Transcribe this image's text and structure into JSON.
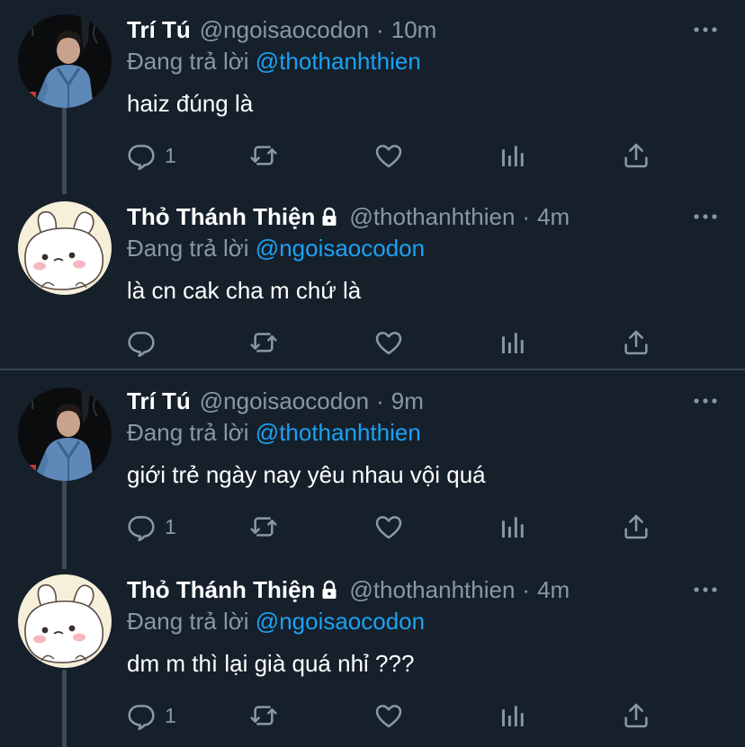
{
  "colors": {
    "background": "#15202b",
    "text": "#ffffff",
    "muted": "#8899a6",
    "mention": "#1da1f2",
    "separator": "#38444d"
  },
  "reply_prefix": "Đang trả lời",
  "time_separator": "·",
  "icons": {
    "more": "more-horizontal-icon",
    "reply": "reply-icon",
    "retweet": "retweet-icon",
    "like": "heart-icon",
    "stats": "stats-icon",
    "share": "share-icon",
    "lock": "lock-icon"
  },
  "tweets": [
    {
      "name": "Trí Tú",
      "handle": "@ngoisaocodon",
      "time": "10m",
      "reply_to": "@thothanhthien",
      "text": "haiz đúng là",
      "reply_count": "1",
      "locked": false
    },
    {
      "name": "Thỏ Thánh Thiện",
      "handle": "@thothanhthien",
      "time": "4m",
      "reply_to": "@ngoisaocodon",
      "text": "là cn cak cha m chứ là",
      "reply_count": "",
      "locked": true
    },
    {
      "name": "Trí Tú",
      "handle": "@ngoisaocodon",
      "time": "9m",
      "reply_to": "@thothanhthien",
      "text": "giới trẻ ngày nay yêu nhau vội quá",
      "reply_count": "1",
      "locked": false
    },
    {
      "name": "Thỏ Thánh Thiện",
      "handle": "@thothanhthien",
      "time": "4m",
      "reply_to": "@ngoisaocodon",
      "text": "dm m thì lại già quá nhỉ ???",
      "reply_count": "1",
      "locked": true
    }
  ]
}
